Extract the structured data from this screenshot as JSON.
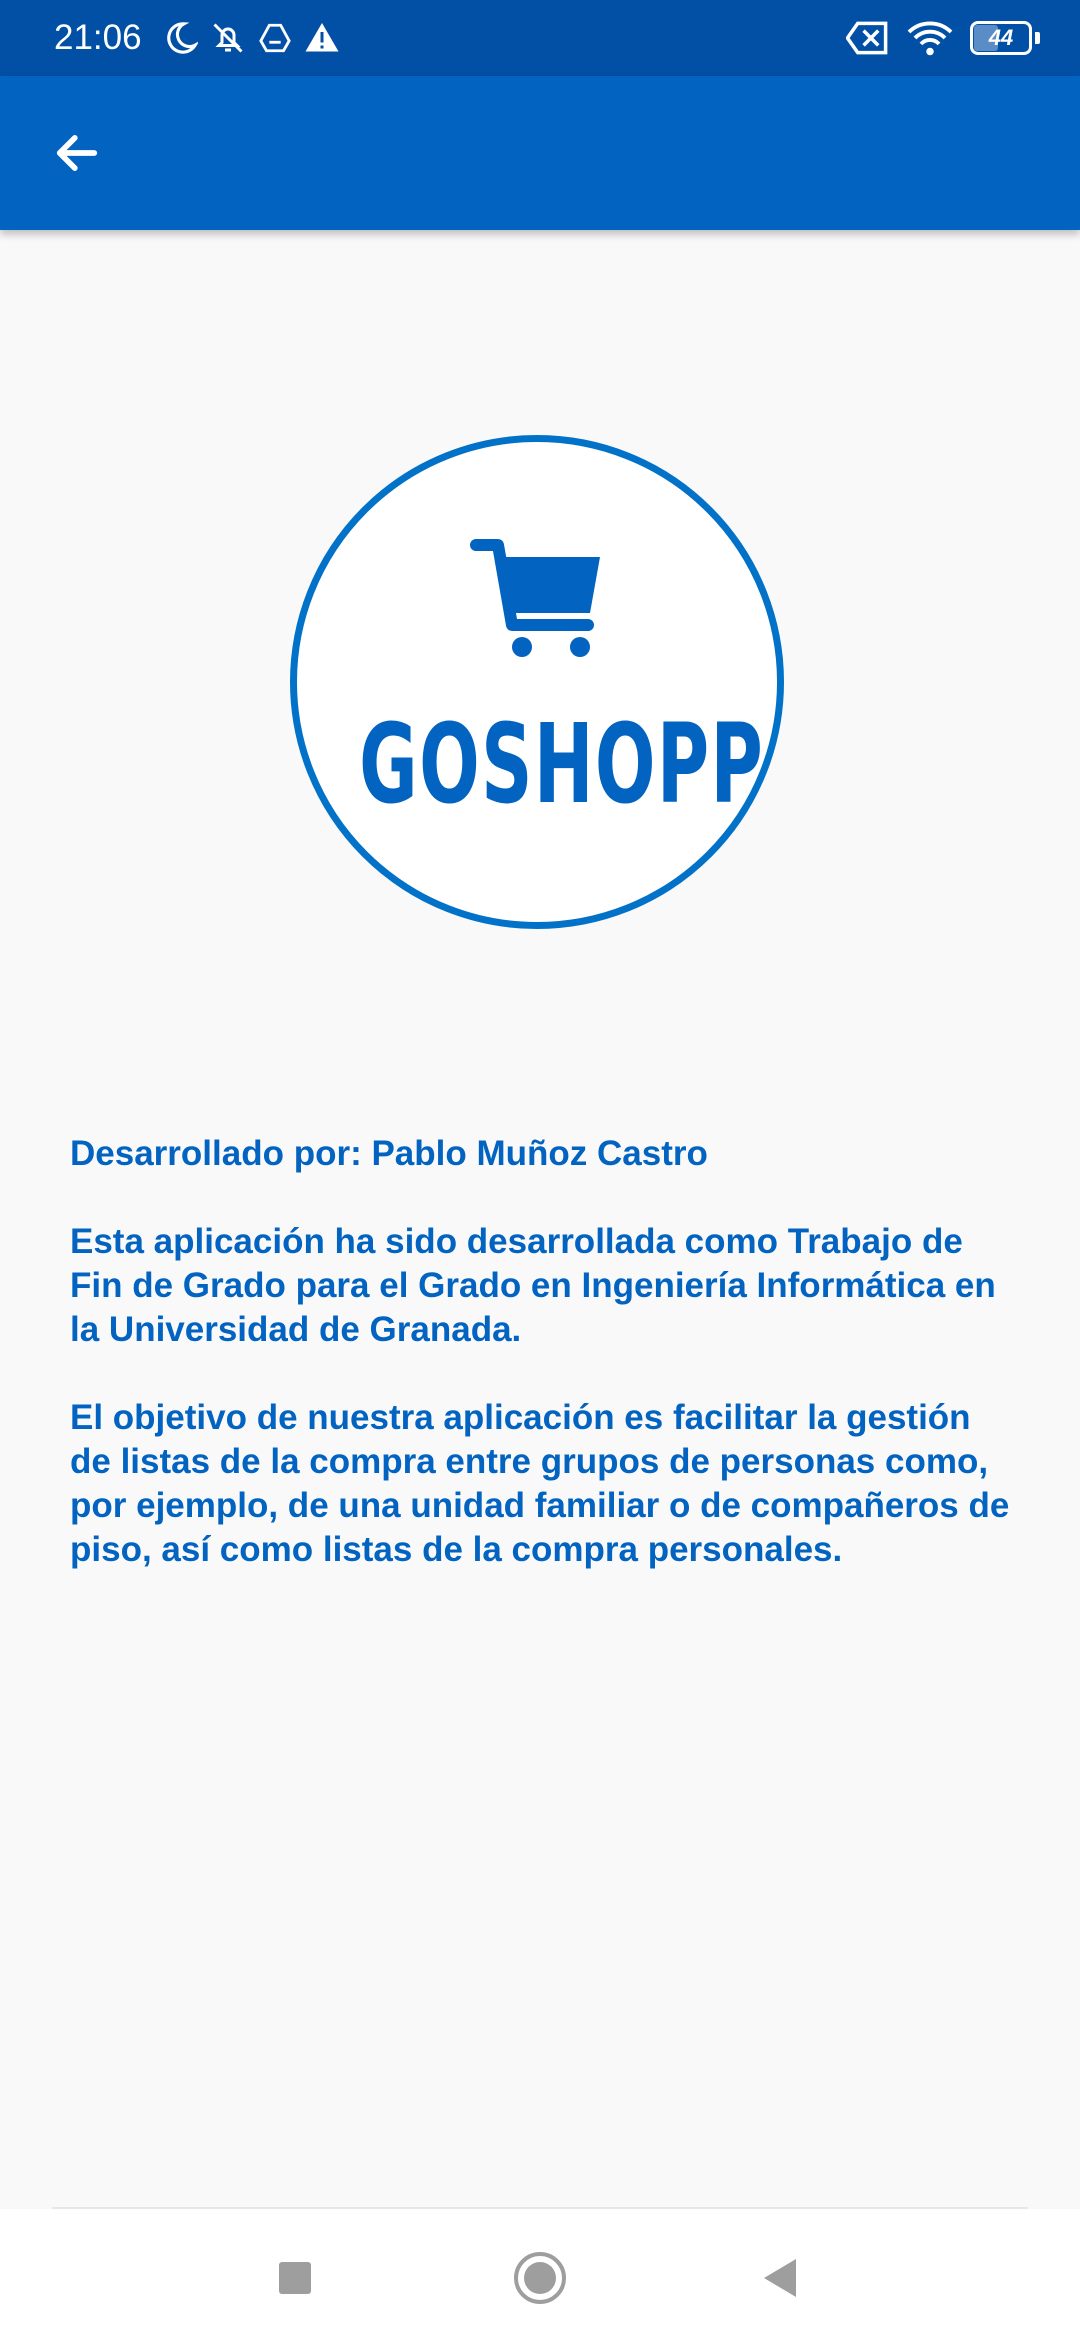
{
  "status_bar": {
    "time": "21:06",
    "left_icons": [
      "moon-icon",
      "bell-off-icon",
      "drive-icon",
      "warning-icon"
    ],
    "right_icons": [
      "sim-off-icon",
      "wifi-icon",
      "battery-icon"
    ],
    "battery_level": "44"
  },
  "app_bar": {
    "back_icon": "arrow-back-icon",
    "color": "#0263c1"
  },
  "logo": {
    "text": "GOSHOPP",
    "icon": "shopping-cart-icon",
    "color": "#0263c1"
  },
  "info": {
    "developer": "Desarrollado por: Pablo Muñoz Castro",
    "paragraph1": "Esta aplicación ha sido desarrollada como Trabajo de Fin de Grado para el Grado en Ingeniería Informática en la Universidad de Granada.",
    "paragraph2": "El objetivo de nuestra aplicación es facilitar la gestión de listas de la compra entre grupos de personas como, por ejemplo, de una unidad familiar o de compañeros de piso, así como listas de la compra personales."
  },
  "nav_bar": {
    "buttons": [
      "recents-square-icon",
      "home-circle-icon",
      "back-triangle-icon"
    ]
  }
}
